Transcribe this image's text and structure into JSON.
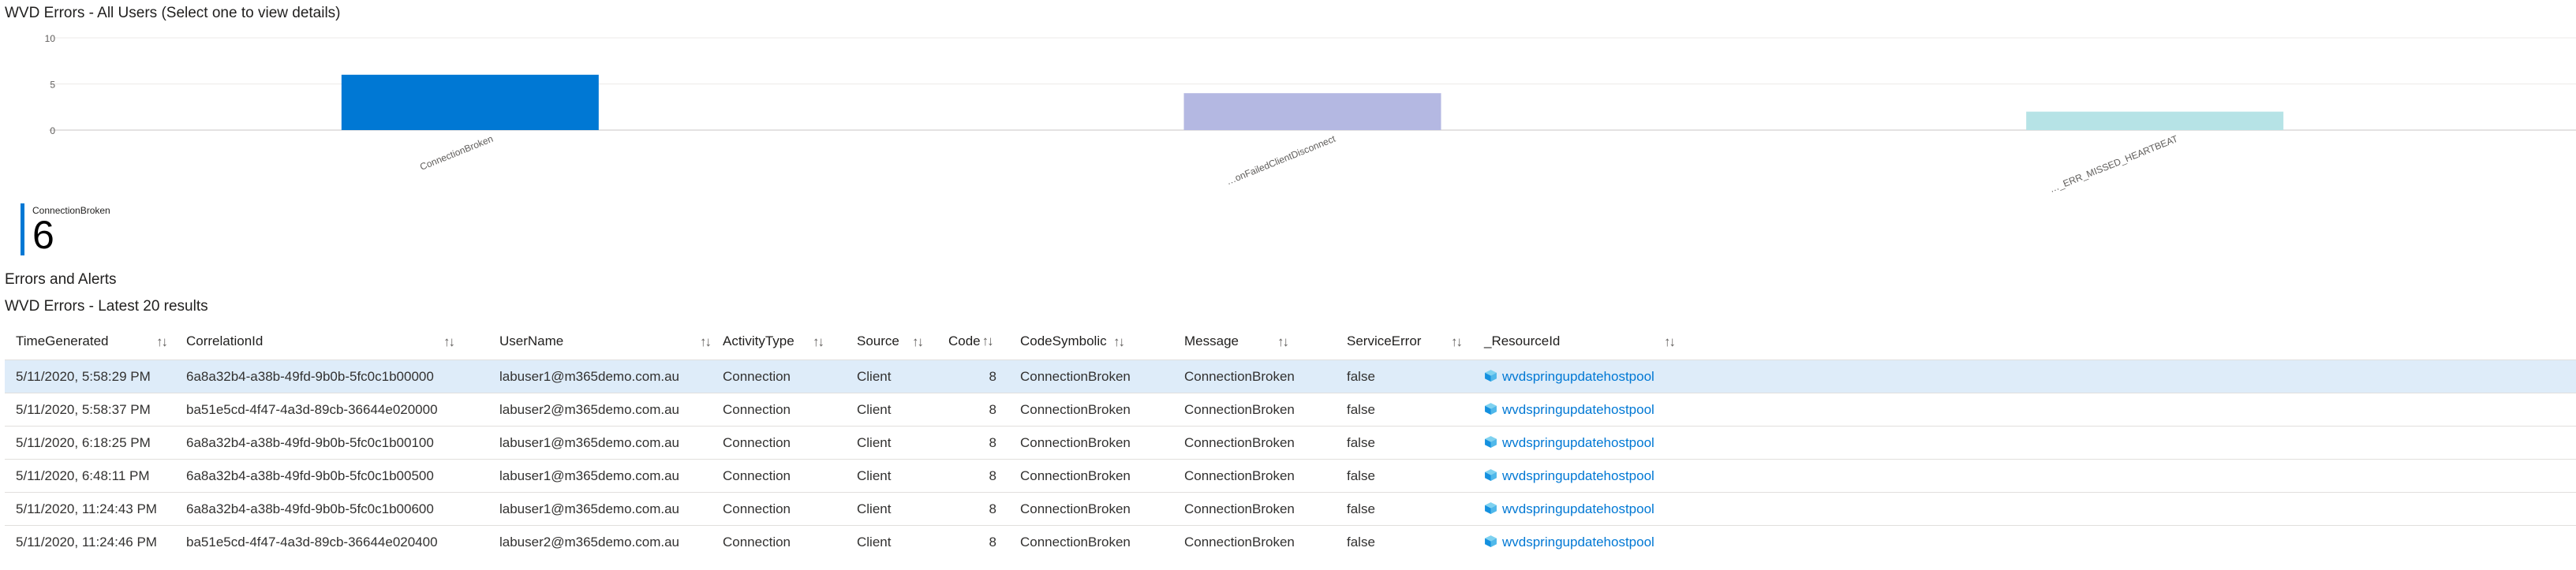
{
  "chart_title": "WVD Errors - All Users (Select one to view details)",
  "chart_data": {
    "type": "bar",
    "categories": [
      "ConnectionBroken",
      "…onFailedClientDisconnect",
      "…_ERR_MISSED_HEARTBEAT"
    ],
    "series": [
      {
        "values": [
          6,
          4,
          2
        ]
      }
    ],
    "colors": [
      "#0078d4",
      "#b4b8e2",
      "#b6e3e6"
    ],
    "ylim": [
      0,
      10
    ],
    "yticks": [
      0,
      5,
      10
    ],
    "grid": true
  },
  "tile": {
    "label": "ConnectionBroken",
    "value": "6",
    "accent": "#0078d4"
  },
  "section_title": "Errors and Alerts",
  "table_title": "WVD Errors - Latest 20 results",
  "table": {
    "columns": [
      "TimeGenerated",
      "CorrelationId",
      "UserName",
      "ActivityType",
      "Source",
      "Code",
      "CodeSymbolic",
      "Message",
      "ServiceError",
      "_ResourceId"
    ],
    "rows": [
      [
        "5/11/2020, 5:58:29 PM",
        "6a8a32b4-a38b-49fd-9b0b-5fc0c1b00000",
        "labuser1@m365demo.com.au",
        "Connection",
        "Client",
        "8",
        "ConnectionBroken",
        "ConnectionBroken",
        "false",
        "wvdspringupdatehostpool"
      ],
      [
        "5/11/2020, 5:58:37 PM",
        "ba51e5cd-4f47-4a3d-89cb-36644e020000",
        "labuser2@m365demo.com.au",
        "Connection",
        "Client",
        "8",
        "ConnectionBroken",
        "ConnectionBroken",
        "false",
        "wvdspringupdatehostpool"
      ],
      [
        "5/11/2020, 6:18:25 PM",
        "6a8a32b4-a38b-49fd-9b0b-5fc0c1b00100",
        "labuser1@m365demo.com.au",
        "Connection",
        "Client",
        "8",
        "ConnectionBroken",
        "ConnectionBroken",
        "false",
        "wvdspringupdatehostpool"
      ],
      [
        "5/11/2020, 6:48:11 PM",
        "6a8a32b4-a38b-49fd-9b0b-5fc0c1b00500",
        "labuser1@m365demo.com.au",
        "Connection",
        "Client",
        "8",
        "ConnectionBroken",
        "ConnectionBroken",
        "false",
        "wvdspringupdatehostpool"
      ],
      [
        "5/11/2020, 11:24:43 PM",
        "6a8a32b4-a38b-49fd-9b0b-5fc0c1b00600",
        "labuser1@m365demo.com.au",
        "Connection",
        "Client",
        "8",
        "ConnectionBroken",
        "ConnectionBroken",
        "false",
        "wvdspringupdatehostpool"
      ],
      [
        "5/11/2020, 11:24:46 PM",
        "ba51e5cd-4f47-4a3d-89cb-36644e020400",
        "labuser2@m365demo.com.au",
        "Connection",
        "Client",
        "8",
        "ConnectionBroken",
        "ConnectionBroken",
        "false",
        "wvdspringupdatehostpool"
      ]
    ],
    "selected_row": 0,
    "sort_icon": "sort-arrows-icon",
    "resource_icon": "cube-icon",
    "link_color": "#0078d4"
  }
}
